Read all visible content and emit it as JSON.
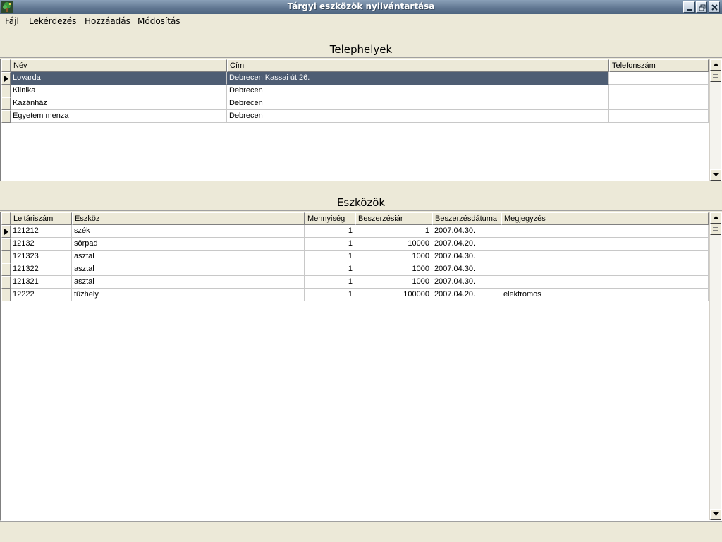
{
  "window": {
    "title": "Tárgyi eszközök nyilvántartása",
    "icon": "app-tree-icon"
  },
  "menu": {
    "items": [
      {
        "label": "Fájl"
      },
      {
        "label": "Lekérdezés"
      },
      {
        "label": "Hozzáadás"
      },
      {
        "label": "Módosítás"
      }
    ]
  },
  "telephelyek": {
    "title": "Telephelyek",
    "columns": [
      "Név",
      "Cím",
      "Telefonszám"
    ],
    "selected_row": 0,
    "rows": [
      {
        "nev": "Lovarda",
        "cim": "Debrecen Kassai út 26.",
        "telefonszam": ""
      },
      {
        "nev": "Klinika",
        "cim": "Debrecen",
        "telefonszam": ""
      },
      {
        "nev": "Kazánház",
        "cim": "Debrecen",
        "telefonszam": ""
      },
      {
        "nev": "Egyetem menza",
        "cim": "Debrecen",
        "telefonszam": ""
      }
    ]
  },
  "eszkozok": {
    "title": "Eszközök",
    "columns": [
      "Leltáriszám",
      "Eszköz",
      "Mennyiség",
      "Beszerzésiár",
      "Beszerzésdátuma",
      "Megjegyzés"
    ],
    "selected_row": 0,
    "rows": [
      {
        "leltariszam": "121212",
        "eszkoz": "szék",
        "mennyiseg": "1",
        "ar": "1",
        "datum": "2007.04.30.",
        "megjegyzes": ""
      },
      {
        "leltariszam": "12132",
        "eszkoz": "sörpad",
        "mennyiseg": "1",
        "ar": "10000",
        "datum": "2007.04.20.",
        "megjegyzes": ""
      },
      {
        "leltariszam": "121323",
        "eszkoz": "asztal",
        "mennyiseg": "1",
        "ar": "1000",
        "datum": "2007.04.30.",
        "megjegyzes": ""
      },
      {
        "leltariszam": "121322",
        "eszkoz": "asztal",
        "mennyiseg": "1",
        "ar": "1000",
        "datum": "2007.04.30.",
        "megjegyzes": ""
      },
      {
        "leltariszam": "121321",
        "eszkoz": "asztal",
        "mennyiseg": "1",
        "ar": "1000",
        "datum": "2007.04.30.",
        "megjegyzes": ""
      },
      {
        "leltariszam": "12222",
        "eszkoz": "tűzhely",
        "mennyiseg": "1",
        "ar": "100000",
        "datum": "2007.04.20.",
        "megjegyzes": "elektromos"
      }
    ]
  }
}
